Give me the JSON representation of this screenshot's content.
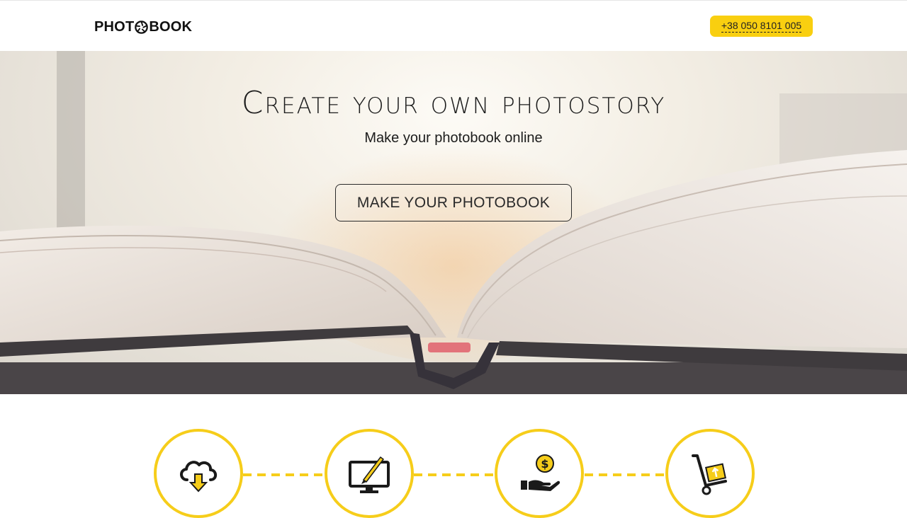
{
  "header": {
    "logo": {
      "text_left": "PHOT",
      "text_right": "BOOK",
      "icon": "camera-shutter-icon"
    },
    "phone": "+38 050 8101 005"
  },
  "hero": {
    "title": "Create your own photostory",
    "subtitle": "Make your photobook online",
    "cta_label": "MAKE YOUR PHOTOBOOK",
    "background": "open-book-photo"
  },
  "steps": [
    {
      "icon": "cloud-upload-icon"
    },
    {
      "icon": "monitor-edit-icon"
    },
    {
      "icon": "hand-coin-icon"
    },
    {
      "icon": "hand-truck-delivery-icon"
    }
  ],
  "colors": {
    "accent": "#f6cd1a",
    "phone_bg": "#f9cf10",
    "text": "#1c1c1c"
  }
}
